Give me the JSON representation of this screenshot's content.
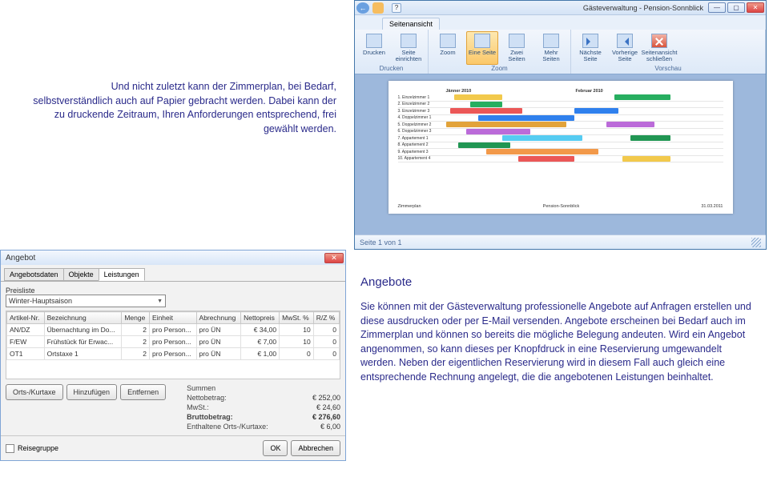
{
  "para1": "Und nicht zuletzt kann der Zimmerplan, bei Bedarf, selbstverständlich auch auf Papier gebracht werden. Dabei kann der zu druckende Zeitraum, Ihren Anforderungen entsprechend, frei gewählt werden.",
  "heading2": "Angebote",
  "para2": "Sie können mit der Gästeverwaltung professionelle Angebote auf Anfragen erstellen und diese ausdrucken oder per E-Mail versenden. Angebote erscheinen bei Bedarf auch im Zimmerplan und können so bereits die mögliche Belegung andeuten. Wird ein Angebot angenommen, so kann dieses per Knopfdruck in eine Reservierung umgewandelt werden. Neben der eigentlichen Reservierung wird in diesem Fall auch gleich eine entsprechende Rechnung angelegt, die die angebotenen Leistungen beinhaltet.",
  "gwin": {
    "title": "Gästeverwaltung - Pension-Sonnblick",
    "help": "?",
    "tab_label": "Seitenansicht",
    "groups": {
      "drucken": {
        "label": "Drucken",
        "btn_drucken": "Drucken",
        "btn_seite_einrichten": "Seite einrichten"
      },
      "zoom": {
        "label": "Zoom",
        "btn_zoom": "Zoom",
        "btn_eine": "Eine Seite",
        "btn_zwei": "Zwei Seiten",
        "btn_mehr": "Mehr Seiten"
      },
      "vorschau": {
        "label": "Vorschau",
        "btn_next": "Nächste Seite",
        "btn_prev": "Vorherige Seite",
        "btn_close": "Seitenansicht schließen"
      }
    },
    "chart": {
      "month1": "Jänner 2010",
      "month2": "Februar 2010",
      "rows": [
        "1. Einzelzimmer 1",
        "2. Einzelzimmer 2",
        "3. Einzelzimmer 3",
        "4. Doppelzimmer 1",
        "5. Doppelzimmer 2",
        "6. Doppelzimmer 3",
        "7. Appartement 1",
        "8. Appartement 2",
        "9. Appartement 3",
        "10. Appartement 4"
      ]
    },
    "footer_left": "Zimmerplan",
    "footer_mid": "Pension-Sonnblick",
    "footer_right": "31.03.2011",
    "status": "Seite 1 von 1"
  },
  "awin": {
    "title": "Angebot",
    "tabs": [
      "Angebotsdaten",
      "Objekte",
      "Leistungen"
    ],
    "preisliste_label": "Preisliste",
    "preisliste_value": "Winter-Hauptsaison",
    "cols": [
      "Artikel-Nr.",
      "Bezeichnung",
      "Menge",
      "Einheit",
      "Abrechnung",
      "Nettopreis",
      "MwSt. %",
      "R/Z %"
    ],
    "rows": [
      {
        "nr": "AN/DZ",
        "bez": "Übernachtung im Do...",
        "menge": "2",
        "einheit": "pro Person...",
        "abr": "pro ÜN",
        "preis": "€ 34,00",
        "mwst": "10",
        "rz": "0"
      },
      {
        "nr": "F/EW",
        "bez": "Frühstück für Erwac...",
        "menge": "2",
        "einheit": "pro Person...",
        "abr": "pro ÜN",
        "preis": "€ 7,00",
        "mwst": "10",
        "rz": "0"
      },
      {
        "nr": "OT1",
        "bez": "Ortstaxe 1",
        "menge": "2",
        "einheit": "pro Person...",
        "abr": "pro ÜN",
        "preis": "€ 1,00",
        "mwst": "0",
        "rz": "0"
      }
    ],
    "btn_orts": "Orts-/Kurtaxe",
    "btn_add": "Hinzufügen",
    "btn_del": "Entfernen",
    "sums": {
      "head": "Summen",
      "netto_l": "Nettobetrag:",
      "netto_v": "€ 252,00",
      "mwst_l": "MwSt.:",
      "mwst_v": "€ 24,60",
      "brutto_l": "Bruttobetrag:",
      "brutto_v": "€ 276,60",
      "enth_l": "Enthaltene Orts-/Kurtaxe:",
      "enth_v": "€ 6,00"
    },
    "reisegruppe": "Reisegruppe",
    "ok": "OK",
    "cancel": "Abbrechen"
  }
}
